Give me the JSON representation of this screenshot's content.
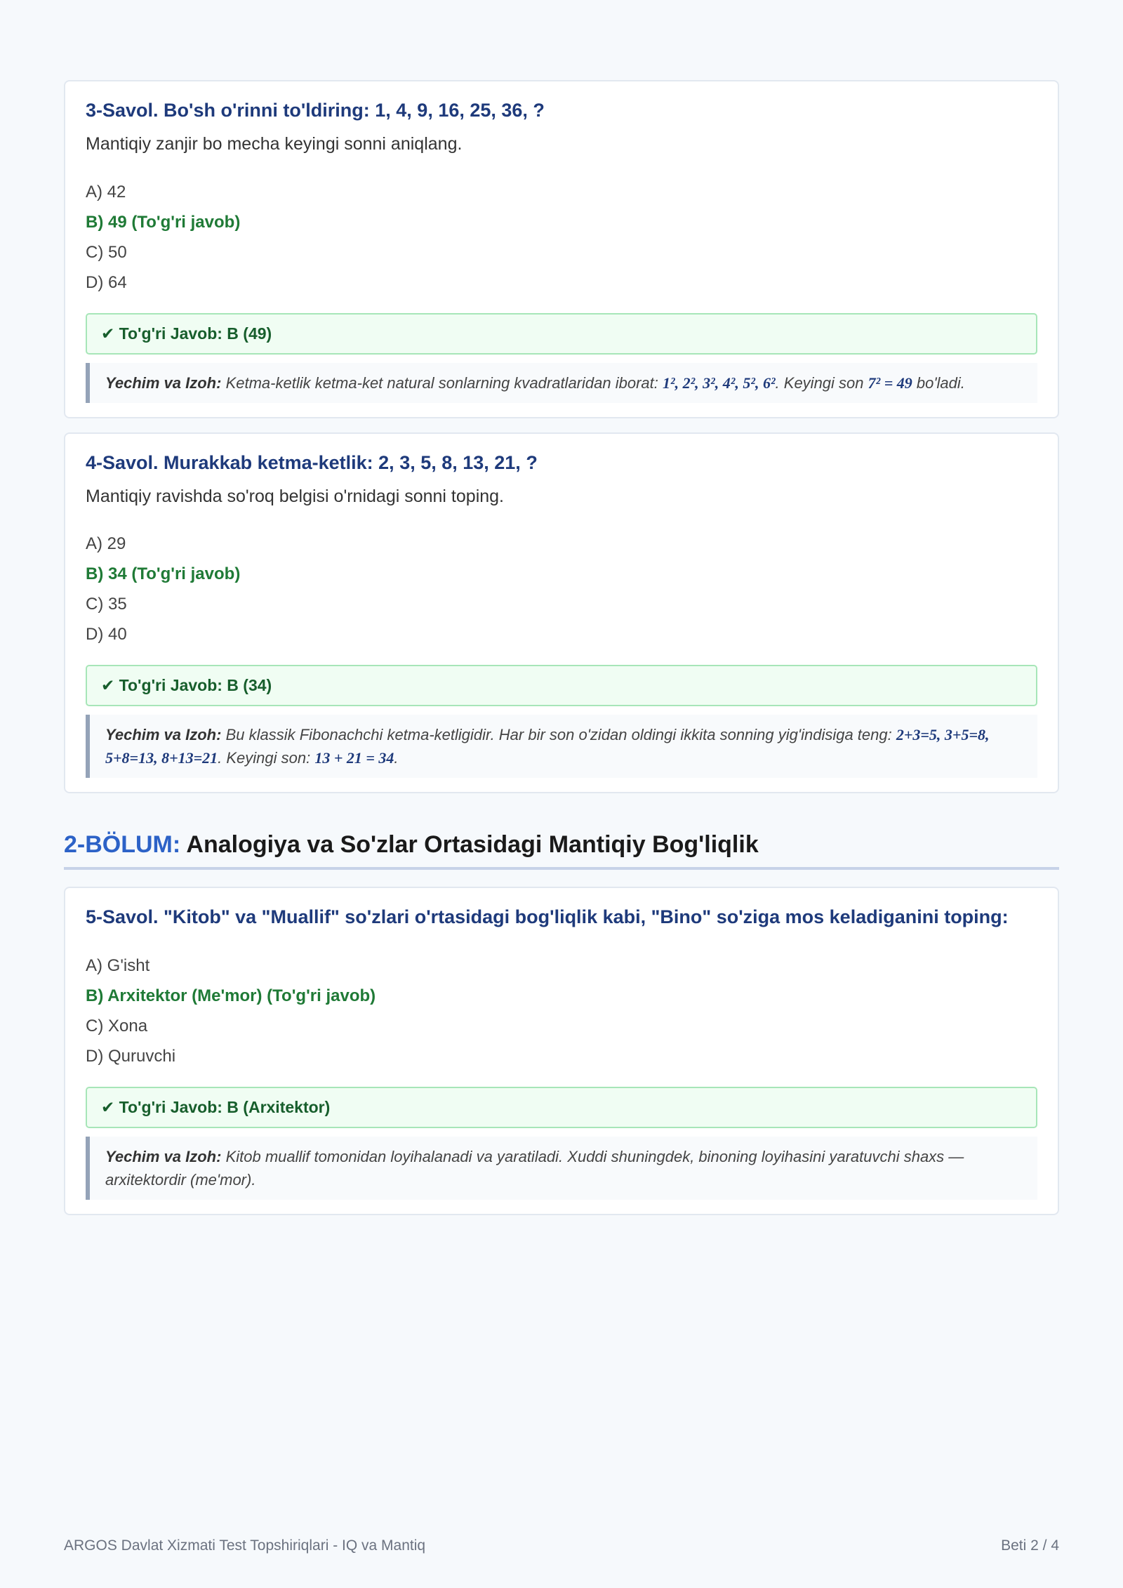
{
  "questions_top": [
    {
      "title": "3-Savol. Bo'sh o'rinni to'ldiring: 1, 4, 9, 16, 25, 36, ?",
      "description": "Mantiqiy zanjir bo mecha keyingi sonni aniqlang.",
      "options": [
        "A) 42",
        "B) 49 (To'g'ri javob)",
        "C) 50",
        "D) 64"
      ],
      "correct_index": 1,
      "answer": "✔ To'g'ri Javob: B (49)",
      "explain_label": "Yechim va Izoh:",
      "explain_parts": [
        {
          "t": " Ketma-ketlik ketma-ket natural sonlarning kvadratlaridan iborat: ",
          "m": false
        },
        {
          "t": "1², 2², 3², 4², 5², 6²",
          "m": true
        },
        {
          "t": ". Keyingi son ",
          "m": false
        },
        {
          "t": "7² = 49",
          "m": true
        },
        {
          "t": " bo'ladi.",
          "m": false
        }
      ]
    },
    {
      "title": "4-Savol. Murakkab ketma-ketlik: 2, 3, 5, 8, 13, 21, ?",
      "description": "Mantiqiy ravishda so'roq belgisi o'rnidagi sonni toping.",
      "options": [
        "A) 29",
        "B) 34 (To'g'ri javob)",
        "C) 35",
        "D) 40"
      ],
      "correct_index": 1,
      "answer": "✔ To'g'ri Javob: B (34)",
      "explain_label": "Yechim va Izoh:",
      "explain_parts": [
        {
          "t": " Bu klassik Fibonachchi ketma-ketligidir. Har bir son o'zidan oldingi ikkita sonning yig'indisiga teng: ",
          "m": false
        },
        {
          "t": "2+3=5, 3+5=8, 5+8=13, 8+13=21",
          "m": true
        },
        {
          "t": ". Keyingi son: ",
          "m": false
        },
        {
          "t": "13 + 21 = 34",
          "m": true
        },
        {
          "t": ".",
          "m": false
        }
      ]
    }
  ],
  "section": {
    "number": "2-BÖLUM:",
    "title": " Analogiya va So'zlar Ortasidagi Mantiqiy Bog'liqlik"
  },
  "questions_bottom": [
    {
      "title": "5-Savol. \"Kitob\" va \"Muallif\" so'zlari o'rtasidagi bog'liqlik kabi, \"Bino\" so'ziga mos keladiganini toping:",
      "description": "",
      "options": [
        "A) G'isht",
        "B) Arxitektor (Me'mor) (To'g'ri javob)",
        "C) Xona",
        "D) Quruvchi"
      ],
      "correct_index": 1,
      "answer": "✔ To'g'ri Javob: B (Arxitektor)",
      "explain_label": "Yechim va Izoh:",
      "explain_parts": [
        {
          "t": " Kitob muallif tomonidan loyihalanadi va yaratiladi. Xuddi shuningdek, binoning loyihasini yaratuvchi shaxs — arxitektordir (me'mor).",
          "m": false
        }
      ]
    }
  ],
  "footer": {
    "left": "ARGOS Davlat Xizmati Test Topshiriqlari - IQ va Mantiq",
    "right": "Beti 2 / 4"
  }
}
